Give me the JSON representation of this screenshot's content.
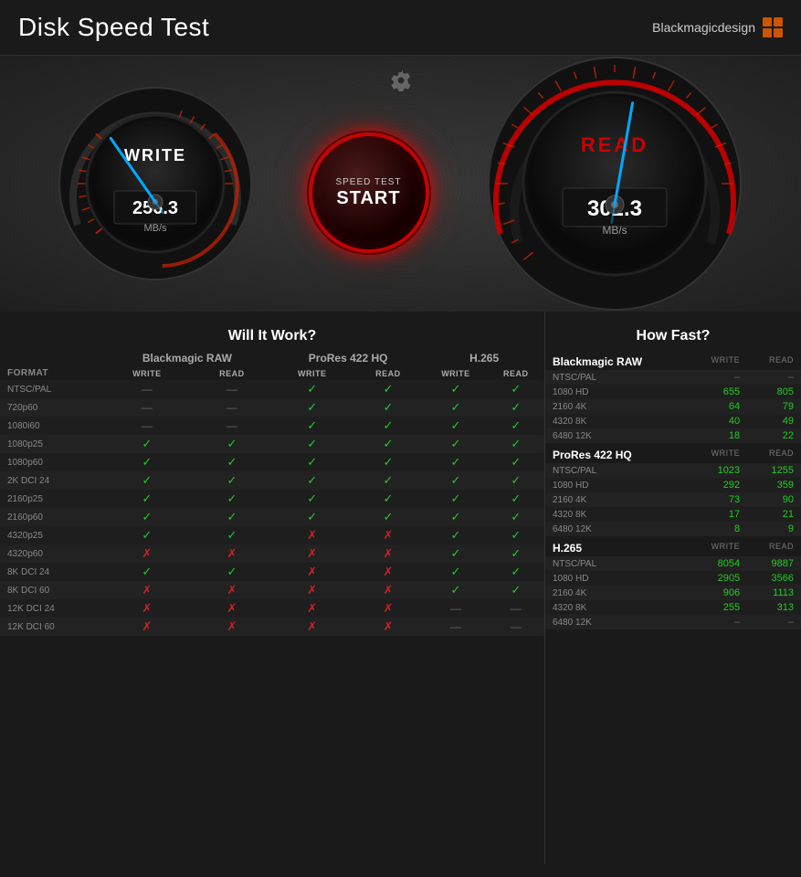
{
  "header": {
    "title": "Disk Speed Test",
    "brand_name": "Blackmagicdesign"
  },
  "gauges": {
    "write": {
      "label": "WRITE",
      "value": "256.3",
      "unit": "MB/s",
      "needle_angle": -30
    },
    "read": {
      "label": "READ",
      "value": "302.3",
      "unit": "MB/s",
      "needle_angle": 10
    },
    "start_button": {
      "line1": "SPEED TEST",
      "line2": "START"
    }
  },
  "will_it_work": {
    "title": "Will It Work?",
    "columns": {
      "format": "FORMAT",
      "blackmagic_raw": "Blackmagic RAW",
      "prores_422hq": "ProRes 422 HQ",
      "h265": "H.265"
    },
    "sub_cols": [
      "WRITE",
      "READ"
    ],
    "rows": [
      {
        "format": "NTSC/PAL",
        "braw_w": "—",
        "braw_r": "—",
        "pro_w": "✓",
        "pro_r": "✓",
        "h_w": "✓",
        "h_r": "✓"
      },
      {
        "format": "720p60",
        "braw_w": "—",
        "braw_r": "—",
        "pro_w": "✓",
        "pro_r": "✓",
        "h_w": "✓",
        "h_r": "✓"
      },
      {
        "format": "1080i60",
        "braw_w": "—",
        "braw_r": "—",
        "pro_w": "✓",
        "pro_r": "✓",
        "h_w": "✓",
        "h_r": "✓"
      },
      {
        "format": "1080p25",
        "braw_w": "✓",
        "braw_r": "✓",
        "pro_w": "✓",
        "pro_r": "✓",
        "h_w": "✓",
        "h_r": "✓"
      },
      {
        "format": "1080p60",
        "braw_w": "✓",
        "braw_r": "✓",
        "pro_w": "✓",
        "pro_r": "✓",
        "h_w": "✓",
        "h_r": "✓"
      },
      {
        "format": "2K DCI 24",
        "braw_w": "✓",
        "braw_r": "✓",
        "pro_w": "✓",
        "pro_r": "✓",
        "h_w": "✓",
        "h_r": "✓"
      },
      {
        "format": "2160p25",
        "braw_w": "✓",
        "braw_r": "✓",
        "pro_w": "✓",
        "pro_r": "✓",
        "h_w": "✓",
        "h_r": "✓"
      },
      {
        "format": "2160p60",
        "braw_w": "✓",
        "braw_r": "✓",
        "pro_w": "✓",
        "pro_r": "✓",
        "h_w": "✓",
        "h_r": "✓"
      },
      {
        "format": "4320p25",
        "braw_w": "✓",
        "braw_r": "✓",
        "pro_w": "✗",
        "pro_r": "✗",
        "h_w": "✓",
        "h_r": "✓"
      },
      {
        "format": "4320p60",
        "braw_w": "✗",
        "braw_r": "✗",
        "pro_w": "✗",
        "pro_r": "✗",
        "h_w": "✓",
        "h_r": "✓"
      },
      {
        "format": "8K DCI 24",
        "braw_w": "✓",
        "braw_r": "✓",
        "pro_w": "✗",
        "pro_r": "✗",
        "h_w": "✓",
        "h_r": "✓"
      },
      {
        "format": "8K DCI 60",
        "braw_w": "✗",
        "braw_r": "✗",
        "pro_w": "✗",
        "pro_r": "✗",
        "h_w": "✓",
        "h_r": "✓"
      },
      {
        "format": "12K DCI 24",
        "braw_w": "✗",
        "braw_r": "✗",
        "pro_w": "✗",
        "pro_r": "✗",
        "h_w": "—",
        "h_r": "—"
      },
      {
        "format": "12K DCI 60",
        "braw_w": "✗",
        "braw_r": "✗",
        "pro_w": "✗",
        "pro_r": "✗",
        "h_w": "—",
        "h_r": "—"
      }
    ]
  },
  "how_fast": {
    "title": "How Fast?",
    "groups": [
      {
        "label": "Blackmagic RAW",
        "sub_headers": [
          "WRITE",
          "READ"
        ],
        "rows": [
          {
            "format": "NTSC/PAL",
            "write": "–",
            "read": "–"
          },
          {
            "format": "1080 HD",
            "write": "655",
            "read": "805"
          },
          {
            "format": "2160 4K",
            "write": "64",
            "read": "79"
          },
          {
            "format": "4320 8K",
            "write": "40",
            "read": "49"
          },
          {
            "format": "6480 12K",
            "write": "18",
            "read": "22"
          }
        ]
      },
      {
        "label": "ProRes 422 HQ",
        "sub_headers": [
          "WRITE",
          "READ"
        ],
        "rows": [
          {
            "format": "NTSC/PAL",
            "write": "1023",
            "read": "1255"
          },
          {
            "format": "1080 HD",
            "write": "292",
            "read": "359"
          },
          {
            "format": "2160 4K",
            "write": "73",
            "read": "90"
          },
          {
            "format": "4320 8K",
            "write": "17",
            "read": "21"
          },
          {
            "format": "6480 12K",
            "write": "8",
            "read": "9"
          }
        ]
      },
      {
        "label": "H.265",
        "sub_headers": [
          "WRITE",
          "READ"
        ],
        "rows": [
          {
            "format": "NTSC/PAL",
            "write": "8054",
            "read": "9887"
          },
          {
            "format": "1080 HD",
            "write": "2905",
            "read": "3566"
          },
          {
            "format": "2160 4K",
            "write": "906",
            "read": "1113"
          },
          {
            "format": "4320 8K",
            "write": "255",
            "read": "313"
          },
          {
            "format": "6480 12K",
            "write": "–",
            "read": "–"
          }
        ]
      }
    ]
  }
}
